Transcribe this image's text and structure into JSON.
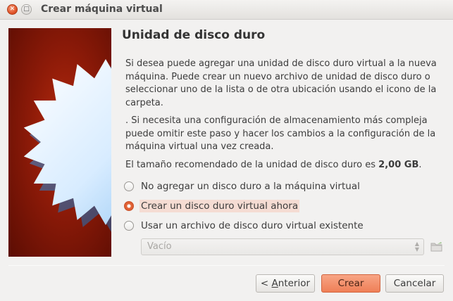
{
  "window": {
    "title": "Crear máquina virtual",
    "close_glyph": "✕",
    "maximize_glyph": "□"
  },
  "heading": "Unidad de disco duro",
  "paragraphs": {
    "p1": "Si desea puede agregar una unidad de disco duro virtual a la nueva máquina. Puede crear un nuevo archivo de unidad de disco duro o seleccionar uno de la lista o de otra ubicación usando el icono de la carpeta.",
    "p2": ". Si necesita una configuración de almacenamiento más compleja puede omitir este paso y hacer los cambios a la configuración de la máquina virtual una vez creada.",
    "p3_prefix": "El tamaño recomendado de la unidad de disco duro es ",
    "p3_size": "2,00 GB",
    "p3_suffix": "."
  },
  "options": [
    {
      "label": "No agregar un disco duro a la máquina virtual",
      "checked": false
    },
    {
      "label": "Crear un disco duro virtual ahora",
      "checked": true
    },
    {
      "label": "Usar un archivo de disco duro virtual existente",
      "checked": false
    }
  ],
  "existing_disk_combo": {
    "value": "Vacío",
    "enabled": false
  },
  "icons": {
    "close": "close-icon",
    "maximize": "maximize-icon",
    "folder": "folder-icon",
    "combo_arrows": "updown-arrows-icon",
    "wizard_art": "starburst-image"
  },
  "buttons": {
    "back_prefix": "< ",
    "back_mnemonic": "A",
    "back_rest": "nterior",
    "create": "Crear",
    "cancel": "Cancelar"
  },
  "colors": {
    "accent": "#ef7f57",
    "selected_row_bg": "#f5dcd3",
    "side_image_dark": "#5b0d03",
    "side_image_light": "#b52a0d"
  }
}
